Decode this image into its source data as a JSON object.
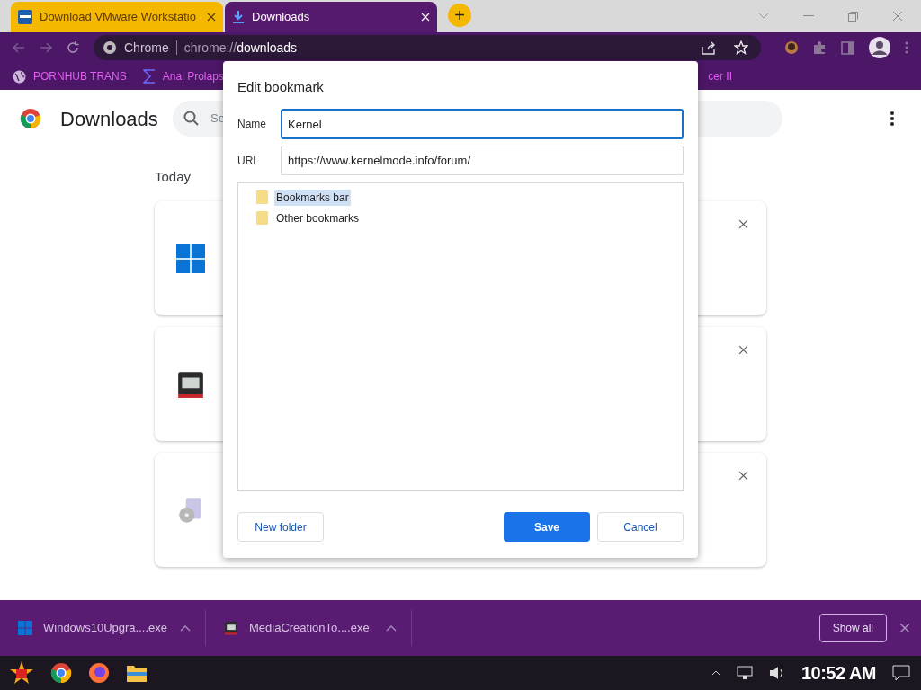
{
  "tabs": [
    {
      "title": "Download VMware Workstatio",
      "selected": false,
      "kind": "vmware"
    },
    {
      "title": "Downloads",
      "selected": true,
      "kind": "download"
    }
  ],
  "new_tab": "+",
  "omnibox": {
    "site": "Chrome",
    "url_prefix": "chrome://",
    "url_path": "downloads"
  },
  "bookmarks": [
    {
      "label": "PORNHUB TRANS",
      "kind": "globe"
    },
    {
      "label": "Anal Prolaps",
      "kind": "sigma"
    },
    {
      "label": "cer II",
      "kind": "plain"
    }
  ],
  "page": {
    "title": "Downloads",
    "search_placeholder": "Se",
    "section": "Today",
    "cards": [
      {
        "kind": "windows"
      },
      {
        "kind": "media"
      },
      {
        "kind": "installer"
      }
    ]
  },
  "dialog": {
    "title": "Edit bookmark",
    "name_label": "Name",
    "name_value": "Kernel",
    "url_label": "URL",
    "url_value": "https://www.kernelmode.info/forum/",
    "folders": [
      {
        "label": "Bookmarks bar",
        "selected": true
      },
      {
        "label": "Other bookmarks",
        "selected": false
      }
    ],
    "buttons": [
      {
        "label": "New folder",
        "kind": "secondary"
      },
      {
        "label": "Save",
        "kind": "primary"
      },
      {
        "label": "Cancel",
        "kind": "secondary"
      }
    ]
  },
  "shelf": {
    "items": [
      {
        "filename": "Windows10Upgra....exe",
        "kind": "windows"
      },
      {
        "filename": "MediaCreationTo....exe",
        "kind": "media"
      }
    ],
    "show_all": "Show all"
  },
  "taskbar": {
    "clock": "10:52 AM"
  }
}
